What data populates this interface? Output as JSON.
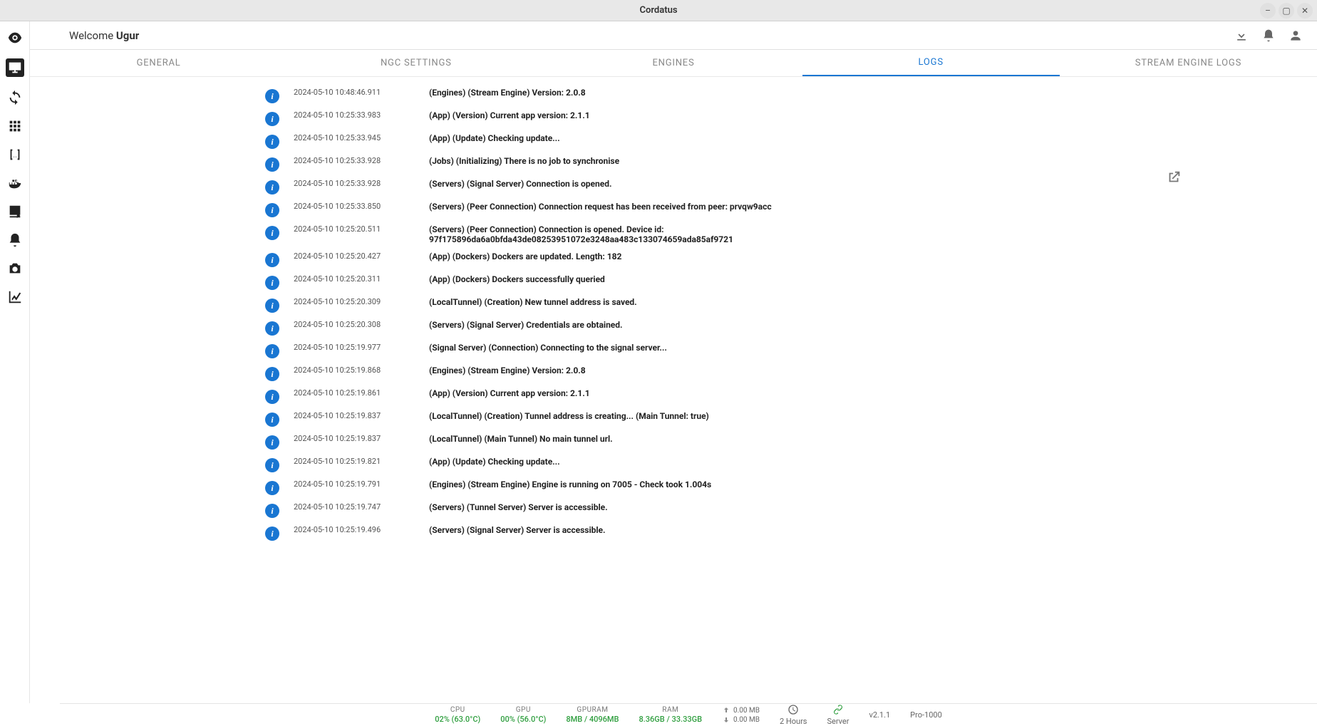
{
  "titlebar": {
    "title": "Cordatus"
  },
  "header": {
    "welcome_prefix": "Welcome ",
    "username": "Ugur"
  },
  "tabs": [
    {
      "label": "GENERAL",
      "active": false
    },
    {
      "label": "NGC SETTINGS",
      "active": false
    },
    {
      "label": "ENGINES",
      "active": false
    },
    {
      "label": "LOGS",
      "active": true
    },
    {
      "label": "STREAM ENGINE LOGS",
      "active": false
    }
  ],
  "logs": [
    {
      "ts": "2024-05-10 10:48:46.911",
      "msg": "(Engines) (Stream Engine) Version: 2.0.8"
    },
    {
      "ts": "2024-05-10 10:25:33.983",
      "msg": "(App) (Version) Current app version: 2.1.1"
    },
    {
      "ts": "2024-05-10 10:25:33.945",
      "msg": "(App) (Update) Checking update..."
    },
    {
      "ts": "2024-05-10 10:25:33.928",
      "msg": "(Jobs) (Initializing) There is no job to synchronise"
    },
    {
      "ts": "2024-05-10 10:25:33.928",
      "msg": "(Servers) (Signal Server) Connection is opened."
    },
    {
      "ts": "2024-05-10 10:25:33.850",
      "msg": "(Servers) (Peer Connection) Connection request has been received from peer: prvqw9acc"
    },
    {
      "ts": "2024-05-10 10:25:20.511",
      "msg": "(Servers) (Peer Connection) Connection is opened. Device id: 97f175896da6a0bfda43de08253951072e3248aa483c133074659ada85af9721"
    },
    {
      "ts": "2024-05-10 10:25:20.427",
      "msg": "(App) (Dockers) Dockers are updated. Length: 182"
    },
    {
      "ts": "2024-05-10 10:25:20.311",
      "msg": "(App) (Dockers) Dockers successfully queried"
    },
    {
      "ts": "2024-05-10 10:25:20.309",
      "msg": "(LocalTunnel) (Creation) New tunnel address is saved."
    },
    {
      "ts": "2024-05-10 10:25:20.308",
      "msg": "(Servers) (Signal Server) Credentials are obtained."
    },
    {
      "ts": "2024-05-10 10:25:19.977",
      "msg": "(Signal Server) (Connection) Connecting to the signal server..."
    },
    {
      "ts": "2024-05-10 10:25:19.868",
      "msg": "(Engines) (Stream Engine) Version: 2.0.8"
    },
    {
      "ts": "2024-05-10 10:25:19.861",
      "msg": "(App) (Version) Current app version: 2.1.1"
    },
    {
      "ts": "2024-05-10 10:25:19.837",
      "msg": "(LocalTunnel) (Creation) Tunnel address is creating... (Main Tunnel: true)"
    },
    {
      "ts": "2024-05-10 10:25:19.837",
      "msg": "(LocalTunnel) (Main Tunnel) No main tunnel url."
    },
    {
      "ts": "2024-05-10 10:25:19.821",
      "msg": "(App) (Update) Checking update..."
    },
    {
      "ts": "2024-05-10 10:25:19.791",
      "msg": "(Engines) (Stream Engine) Engine is running on 7005 - Check took 1.004s"
    },
    {
      "ts": "2024-05-10 10:25:19.747",
      "msg": "(Servers) (Tunnel Server) Server is accessible."
    },
    {
      "ts": "2024-05-10 10:25:19.496",
      "msg": "(Servers) (Signal Server) Server is accessible."
    }
  ],
  "footer": {
    "cpu_label": "CPU",
    "cpu_value": "02% (63.0°C)",
    "gpu_label": "GPU",
    "gpu_value": "00% (56.0°C)",
    "gpuram_label": "GPURAM",
    "gpuram_value": "8MB / 4096MB",
    "ram_label": "RAM",
    "ram_value": "8.36GB / 33.33GB",
    "net_up": "0.00 MB",
    "net_down": "0.00 MB",
    "uptime": "2 Hours",
    "server_label": "Server",
    "version": "v2.1.1",
    "plan": "Pro-1000"
  }
}
